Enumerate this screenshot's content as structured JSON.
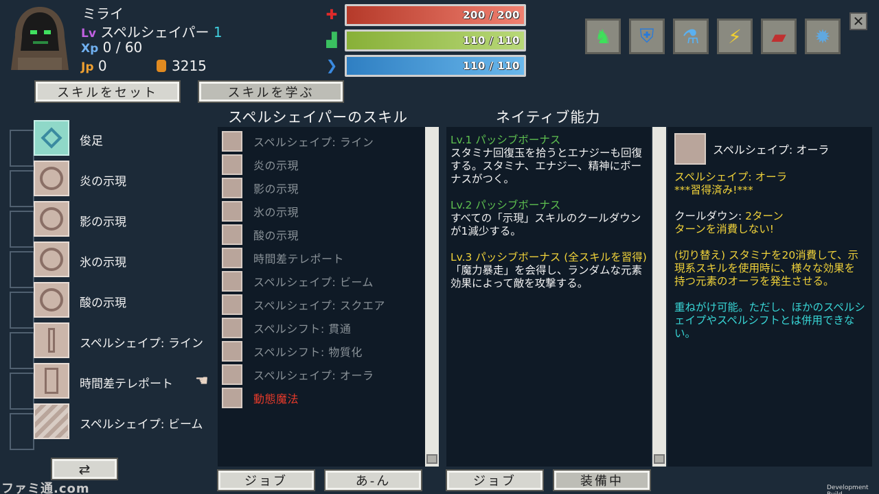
{
  "character": {
    "name": "ミライ",
    "lv_label": "Lv",
    "job": "スペルシェイパー",
    "level": "1",
    "xp_label": "Xp",
    "xp": "0 / 60",
    "jp_label": "Jp",
    "jp": "0",
    "gold": "3215"
  },
  "stats": {
    "hp": {
      "text": "200 / 200",
      "fraction": 1.0,
      "icon": "red-cross-icon"
    },
    "stamina": {
      "text": "110 / 110",
      "fraction": 1.0,
      "icon": "green-boot-icon"
    },
    "mana": {
      "text": "110 / 110",
      "fraction": 1.0,
      "icon": "blue-feather-icon"
    }
  },
  "menu_icons": [
    "body-icon",
    "shield-icon",
    "potion-icon",
    "lightning-map-icon",
    "book-icon",
    "gear-icon"
  ],
  "buttons": {
    "set_skill": "スキルをセット",
    "learn_skill": "スキルを学ぶ",
    "job": "ジョブ",
    "sort": "あ-ん",
    "job2": "ジョブ",
    "equipped": "装備中",
    "swap_icon": "⇄",
    "close": "✕"
  },
  "left_skills": [
    {
      "name": "俊足"
    },
    {
      "name": "炎の示現"
    },
    {
      "name": "影の示現"
    },
    {
      "name": "氷の示現"
    },
    {
      "name": "酸の示現"
    },
    {
      "name": "スペルシェイプ: ライン"
    },
    {
      "name": "時間差テレポート"
    },
    {
      "name": "スペルシェイプ: ビーム"
    }
  ],
  "skill_panel": {
    "title": "スペルシェイパーのスキル",
    "items": [
      {
        "name": "スペルシェイプ: ライン"
      },
      {
        "name": "炎の示現"
      },
      {
        "name": "影の示現"
      },
      {
        "name": "氷の示現"
      },
      {
        "name": "酸の示現"
      },
      {
        "name": "時間差テレポート"
      },
      {
        "name": "スペルシェイプ: ビーム"
      },
      {
        "name": "スペルシェイプ: スクエア"
      },
      {
        "name": "スペルシフト: 貫通"
      },
      {
        "name": "スペルシフト: 物質化"
      },
      {
        "name": "スペルシェイプ: オーラ"
      },
      {
        "name": "動態魔法"
      }
    ]
  },
  "native_panel": {
    "title": "ネイティブ能力",
    "lv1_title": "Lv.1 パッシブボーナス",
    "lv1_body": "スタミナ回復玉を拾うとエナジーも回復する。スタミナ、エナジー、精神にボーナスがつく。",
    "lv2_title": "Lv.2 パッシブボーナス",
    "lv2_body": "すべての「示現」スキルのクールダウンが1減少する。",
    "lv3_title": "Lv.3 パッシブボーナス (全スキルを習得)",
    "lv3_body": "「魔力暴走」を会得し、ランダムな元素効果によって敵を攻撃する。"
  },
  "detail_panel": {
    "header": "スペルシェイプ: オーラ",
    "name": "スペルシェイプ: オーラ",
    "learned": "***習得済み!***",
    "cooldown_label": "クールダウン:",
    "cooldown_value": "2ターン",
    "no_turn": "ターンを消費しない!",
    "desc": "(切り替え) スタミナを20消費して、示現系スキルを使用時に、様々な効果を持つ元素のオーラを発生させる。",
    "stack": "重ねがけ可能。ただし、ほかのスペルシェイプやスペルシフトとは併用できない。"
  },
  "footer": {
    "dev_build": "Development Build",
    "watermark": "ファミ通.com"
  }
}
